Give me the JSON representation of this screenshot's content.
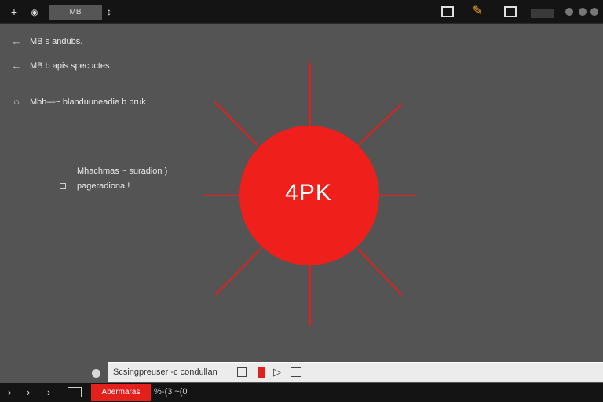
{
  "colors": {
    "accent": "#e3201c",
    "background": "#545454",
    "bar": "#141414"
  },
  "topbar": {
    "icons_left": [
      {
        "name": "plus-icon",
        "glyph": "+"
      },
      {
        "name": "diamond-icon",
        "glyph": "◈"
      }
    ],
    "tab_label": "MB",
    "tab_arrow_glyph": "↕",
    "icons_right": [
      {
        "name": "window-icon",
        "glyph": "▣"
      },
      {
        "name": "pencil-icon",
        "glyph": "✎"
      },
      {
        "name": "edit-box-icon",
        "glyph": "✐"
      }
    ]
  },
  "left_list": [
    {
      "glyph": "←",
      "icon": "back-arrow-icon",
      "label": "MB s andubs."
    },
    {
      "glyph": "←",
      "icon": "back-arrow-icon",
      "label": "MB b apis specuctes."
    },
    {
      "glyph": "○",
      "icon": "circle-icon",
      "label": "Mbh—~ blanduuneadie b bruk"
    }
  ],
  "note": {
    "line1": "Mhachmas ~ suradion )",
    "line2": "pageradiona !"
  },
  "badge": {
    "label": "4PK",
    "color": "#ef1f1c"
  },
  "bottom_toolbar": {
    "text": "Scsingpreuser -c condullan",
    "play_glyph": "▷"
  },
  "bottom_bar": {
    "arrows": [
      "›",
      "›",
      "›"
    ],
    "red_label": "Abermaras",
    "trail_text": "%-(3 ~(0"
  }
}
